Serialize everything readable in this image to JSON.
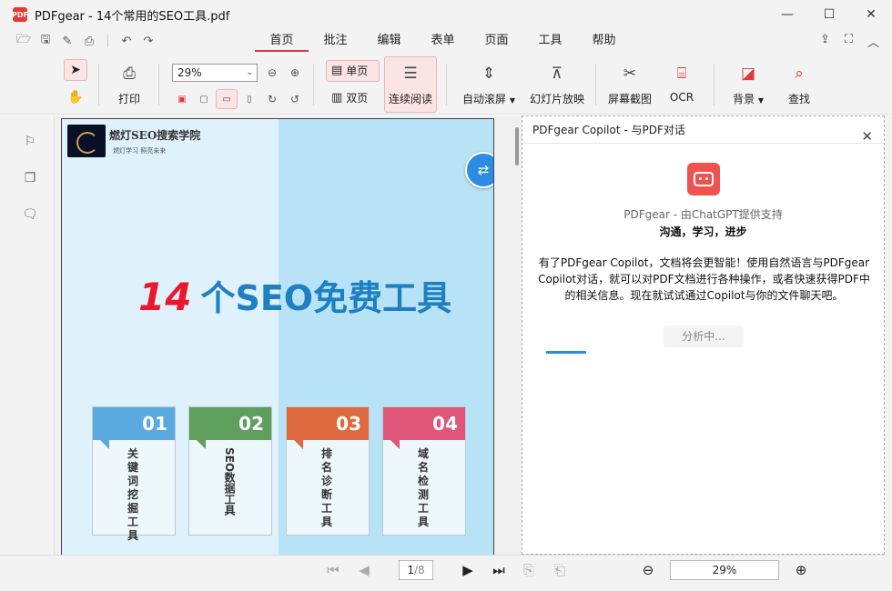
{
  "window": {
    "title": "PDFgear - 14个常用的SEO工具.pdf",
    "logo_text": "PDF",
    "minimize": "—",
    "maximize": "☐",
    "close": "✕"
  },
  "menu": {
    "tabs": [
      "首页",
      "批注",
      "编辑",
      "表单",
      "页面",
      "工具",
      "帮助"
    ],
    "active_tab": "首页"
  },
  "ribbon": {
    "print": "打印",
    "zoom": "29%",
    "single_page": "单页",
    "double_page": "双页",
    "continuous": "连续阅读",
    "auto_scroll": "自动滚屏",
    "slideshow": "幻灯片放映",
    "screenshot": "屏幕截图",
    "ocr": "OCR",
    "background": "背景",
    "find": "查找"
  },
  "document": {
    "brand": "燃灯SEO搜索学院",
    "brand_sub": "燃灯学习  照亮未来",
    "headline_num": "14",
    "headline_text": "个SEO免费工具",
    "cards": [
      {
        "num": "01",
        "label": "关键词挖掘工具",
        "color": "#5aa9df"
      },
      {
        "num": "02",
        "label": "SEO数据工具",
        "color": "#5e9f5e"
      },
      {
        "num": "03",
        "label": "排名诊断工具",
        "color": "#de6a3f"
      },
      {
        "num": "04",
        "label": "域名检测工具",
        "color": "#e0567a"
      }
    ]
  },
  "copilot": {
    "header": "PDFgear Copilot - 与PDF对话",
    "powered": "PDFgear - 由ChatGPT提供支持",
    "slogan": "沟通，学习，进步",
    "intro": "有了PDFgear Copilot，文档将会更智能！使用自然语言与PDFgear Copilot对话，就可以对PDF文档进行各种操作，或者快速获得PDF中的相关信息。现在就试试通过Copilot与你的文件聊天吧。",
    "status": "分析中..."
  },
  "pager": {
    "current": "1",
    "total": "/8",
    "zoom": "29%"
  }
}
